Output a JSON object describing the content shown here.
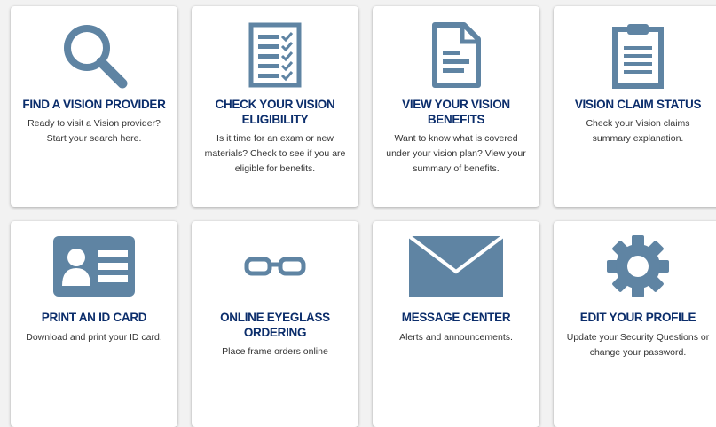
{
  "theme": {
    "icon_color": "#5f84a3",
    "title_color": "#0b2d6b",
    "text_color": "#333333"
  },
  "cards": [
    {
      "icon": "search-icon",
      "title": "FIND A VISION PROVIDER",
      "description": "Ready to visit a Vision provider? Start your search here."
    },
    {
      "icon": "checklist-icon",
      "title": "CHECK YOUR VISION ELIGIBILITY",
      "description": "Is it time for an exam or new materials? Check to see if you are eligible for benefits."
    },
    {
      "icon": "document-icon",
      "title": "VIEW YOUR VISION BENEFITS",
      "description": "Want to know what is covered under your vision plan? View your summary of benefits."
    },
    {
      "icon": "clipboard-icon",
      "title": "VISION CLAIM STATUS",
      "description": "Check your Vision claims summary explanation."
    },
    {
      "icon": "id-card-icon",
      "title": "PRINT AN ID CARD",
      "description": "Download and print your ID card."
    },
    {
      "icon": "eyeglasses-icon",
      "title": "ONLINE EYEGLASS ORDERING",
      "description": "Place frame orders online"
    },
    {
      "icon": "envelope-icon",
      "title": "MESSAGE CENTER",
      "description": "Alerts and announcements."
    },
    {
      "icon": "gear-icon",
      "title": "EDIT YOUR PROFILE",
      "description": "Update your Security Questions or change your password."
    }
  ]
}
